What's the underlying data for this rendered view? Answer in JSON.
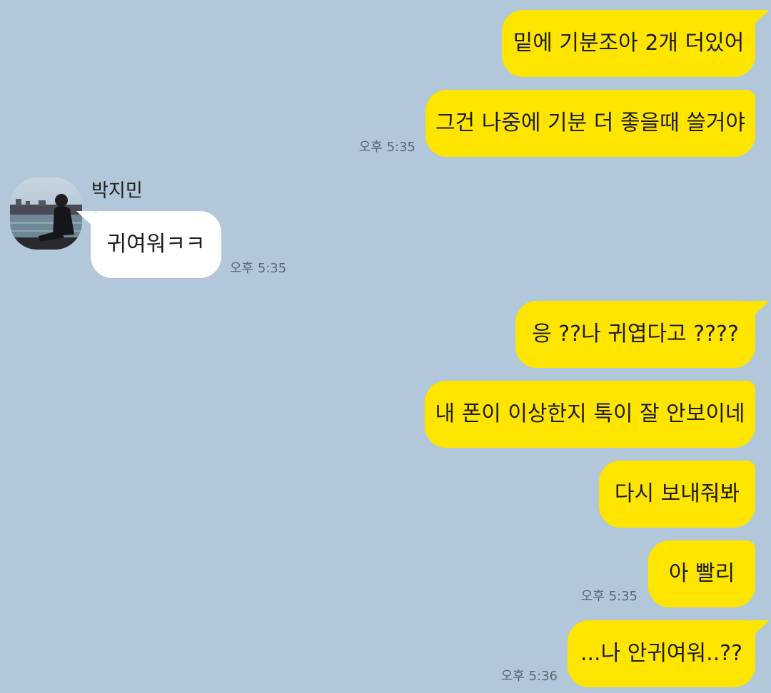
{
  "conversation": {
    "messages": [
      {
        "from": "me",
        "text": "밑에 기분조아 2개 더있어"
      },
      {
        "from": "me",
        "text": "그건 나중에 기분 더 좋을때 쓸거야",
        "time": "오후 5:35"
      },
      {
        "from": "them",
        "sender": "박지민",
        "text": "귀여워ㅋㅋ",
        "time": "오후 5:35"
      },
      {
        "from": "me",
        "text": "응 ??나 귀엽다고 ????"
      },
      {
        "from": "me",
        "text": "내 폰이 이상한지 톡이 잘 안보이네"
      },
      {
        "from": "me",
        "text": "다시 보내줘봐"
      },
      {
        "from": "me",
        "text": "아 빨리",
        "time": "오후 5:35"
      },
      {
        "from": "me",
        "text": "...나 안귀여워..??",
        "time": "오후 5:36"
      }
    ]
  },
  "colors": {
    "background": "#b2c7da",
    "my_bubble": "#fee500",
    "their_bubble": "#ffffff"
  }
}
